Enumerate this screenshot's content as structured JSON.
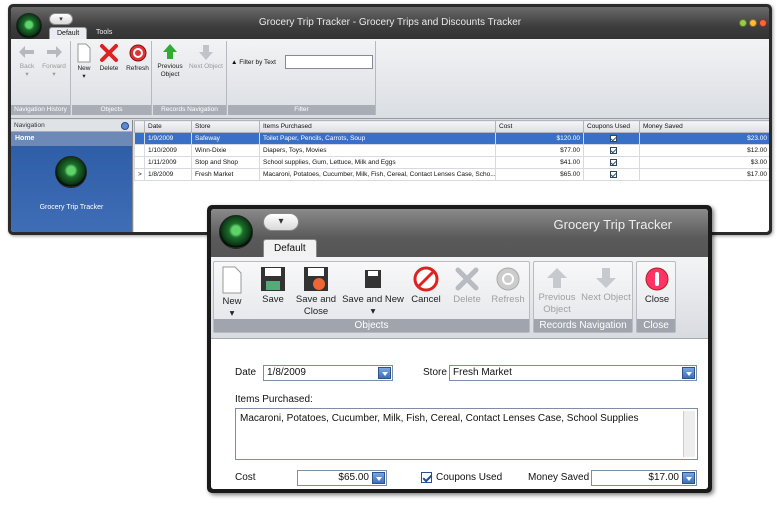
{
  "main_window": {
    "title": "Grocery Trip Tracker - Grocery Trips and Discounts Tracker",
    "qat_glyph": "▾",
    "tabs": [
      {
        "label": "Default",
        "active": true
      },
      {
        "label": "Tools",
        "active": false
      }
    ],
    "ribbon": {
      "groups": {
        "navigation_history": "Navigation History",
        "objects": "Objects",
        "records_navigation": "Records Navigation",
        "filter": "Filter"
      },
      "buttons": {
        "back": "Back",
        "forward": "Forward",
        "new": "New",
        "delete": "Delete",
        "refresh": "Refresh",
        "previous_object": "Previous Object",
        "next_object": "Next Object"
      },
      "filter_label": "Filter by Text",
      "filter_value": ""
    },
    "navigation": {
      "header": "Navigation",
      "home": "Home",
      "item_label": "Grocery Trip Tracker"
    },
    "grid": {
      "columns": [
        "Date",
        "Store",
        "Items Purchased",
        "Cost",
        "Coupons Used",
        "Money Saved"
      ],
      "rows": [
        {
          "date": "1/9/2009",
          "store": "Safeway",
          "items": "Toilet Paper, Pencils, Carrots, Soup",
          "cost": "$120.00",
          "coupons": true,
          "saved": "$23.00",
          "selected": true,
          "marker": ""
        },
        {
          "date": "1/10/2009",
          "store": "Winn-Dixie",
          "items": "Diapers, Toys, Movies",
          "cost": "$77.00",
          "coupons": true,
          "saved": "$12.00",
          "selected": false,
          "marker": ""
        },
        {
          "date": "1/11/2009",
          "store": "Stop and Shop",
          "items": "School supplies, Gum, Lettuce, Milk and Eggs",
          "cost": "$41.00",
          "coupons": true,
          "saved": "$3.00",
          "selected": false,
          "marker": ""
        },
        {
          "date": "1/8/2009",
          "store": "Fresh Market",
          "items": "Macaroni, Potatoes, Cucumber, Milk, Fish, Cereal, Contact Lenses Case, Scho...",
          "cost": "$65.00",
          "coupons": true,
          "saved": "$17.00",
          "selected": false,
          "marker": ">"
        }
      ]
    }
  },
  "detail_window": {
    "title": "Grocery Trip Tracker",
    "qat_glyph": "▾",
    "tab": "Default",
    "ribbon": {
      "groups": {
        "objects": "Objects",
        "records_navigation": "Records Navigation",
        "close": "Close"
      },
      "buttons": {
        "new": "New",
        "save": "Save",
        "save_and_close": "Save and Close",
        "save_and_new": "Save and New",
        "cancel": "Cancel",
        "delete": "Delete",
        "refresh": "Refresh",
        "previous_object": "Previous Object",
        "next_object": "Next Object",
        "close": "Close"
      }
    },
    "form": {
      "date_label": "Date",
      "date_value": "1/8/2009",
      "store_label": "Store",
      "store_value": "Fresh Market",
      "items_label": "Items Purchased:",
      "items_value": "Macaroni, Potatoes, Cucumber, Milk, Fish, Cereal, Contact Lenses Case, School Supplies",
      "cost_label": "Cost",
      "cost_value": "$65.00",
      "coupons_label": "Coupons Used",
      "coupons_checked": true,
      "money_saved_label": "Money Saved",
      "money_saved_value": "$17.00"
    }
  },
  "colors": {
    "selection": "#3970c7",
    "nav_panel": "#2f5ea8",
    "title_bar": "#3d3d3d"
  }
}
